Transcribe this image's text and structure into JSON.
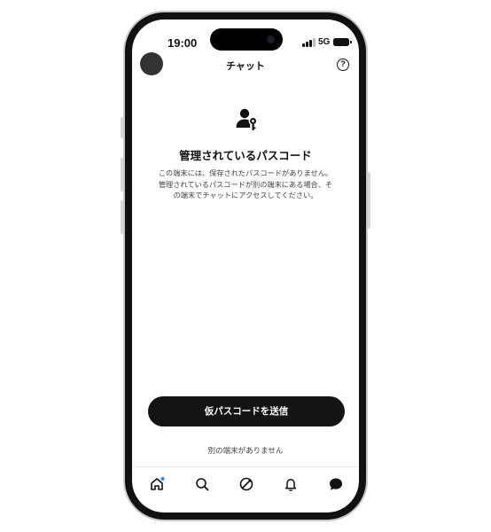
{
  "status_bar": {
    "time": "19:00",
    "network": "5G"
  },
  "header": {
    "title": "チャット",
    "help_icon": "help-circle-icon"
  },
  "content": {
    "icon": "person-key-icon",
    "heading": "管理されているパスコード",
    "description_lines": [
      "この端末には、保存されたパスコードがありません。",
      "管理されているパスコードが別の端末にある場合、そ",
      "の端末でチャットにアクセスしてください。"
    ]
  },
  "actions": {
    "primary_label": "仮パスコードを送信",
    "secondary_label": "別の端末がありません"
  },
  "tabbar": {
    "items": [
      {
        "icon": "home-icon"
      },
      {
        "icon": "search-icon"
      },
      {
        "icon": "compass-icon"
      },
      {
        "icon": "bell-icon"
      },
      {
        "icon": "chat-bubble-icon"
      }
    ]
  },
  "colors": {
    "primary_button": "#141414",
    "text": "#111111",
    "muted_text": "#444444",
    "notification_dot": "#3b82f6"
  }
}
